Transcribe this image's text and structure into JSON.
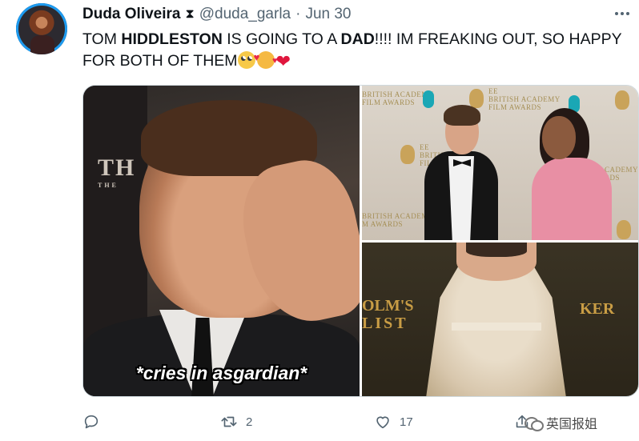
{
  "tweet": {
    "author": {
      "name": "Duda Oliveira",
      "name_emoji": "⧗",
      "handle": "@duda_garla",
      "separator": "·",
      "date": "Jun 30"
    },
    "text_parts": {
      "p1": "TOM ",
      "p2": "HIDDLESTON",
      "p3": " IS GOING TO A ",
      "p4": "DAD",
      "p5": "!!!! IM FREAKING OUT, SO HAPPY FOR BOTH OF THEM"
    },
    "emojis": [
      "face-with-rolling-eyes",
      "smiling-face-with-hearts",
      "red-heart"
    ],
    "media": {
      "image1": {
        "caption": "*cries in asgardian*",
        "sign_text": "TH",
        "sign_sub": "THE"
      },
      "image2": {
        "board_lines_top_left": [
          "BRITISH ACADEMY",
          "FILM AWARDS"
        ],
        "board_lines_top_right": [
          "EE",
          "BRITISH ACADEMY",
          "FILM AWARDS"
        ],
        "board_lines_mid_left": [
          "EE",
          "BRITISH",
          "FILM"
        ],
        "board_lines_right": [
          "ACADEMY",
          "ARDS"
        ],
        "board_lines_bottom_left": [
          "BRITISH ACADEMY",
          "M AWARDS"
        ]
      },
      "image3": {
        "left_text_line1": "OLM'S",
        "left_text_line2": "LIST",
        "right_text": "KER"
      }
    },
    "actions": {
      "reply_count": "",
      "retweet_count": "2",
      "like_count": "17",
      "share_count": ""
    },
    "watermark": "英国报姐",
    "colors": {
      "accent": "#1d9bf0",
      "text": "#0f1419",
      "muted": "#536471",
      "heart": "#e0163d"
    }
  }
}
